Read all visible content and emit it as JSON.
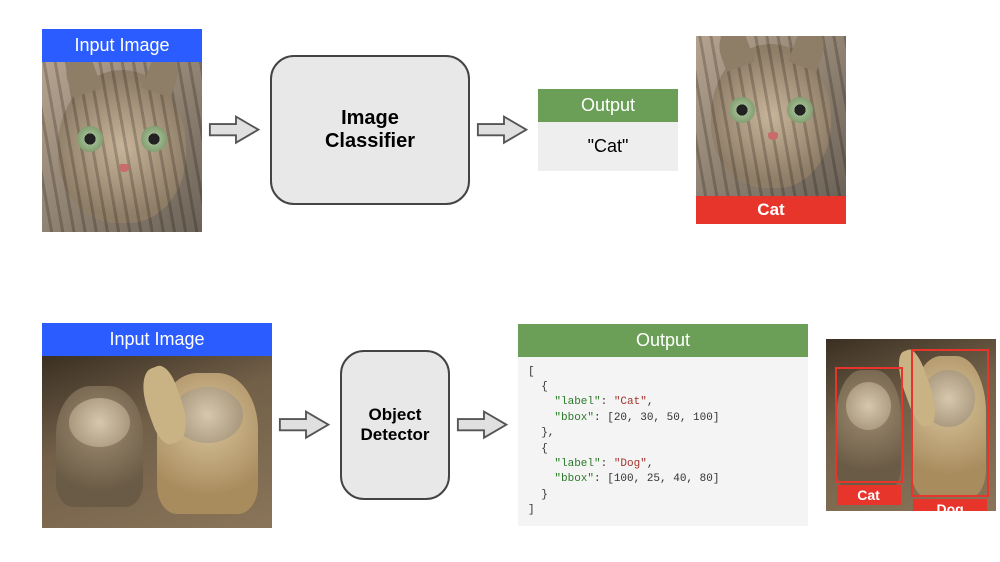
{
  "row1": {
    "input_label": "Input Image",
    "model_label": "Image Classifier",
    "output_header": "Output",
    "output_value": "\"Cat\"",
    "result_caption": "Cat"
  },
  "row2": {
    "input_label": "Input Image",
    "model_label": "Object Detector",
    "output_header": "Output",
    "json": {
      "open": "[",
      "item1": {
        "label_key": "\"label\"",
        "label_val": "\"Cat\"",
        "bbox_key": "\"bbox\"",
        "bbox_val": "[20, 30, 50, 100]"
      },
      "item2": {
        "label_key": "\"label\"",
        "label_val": "\"Dog\"",
        "bbox_key": "\"bbox\"",
        "bbox_val": "[100, 25, 40, 80]"
      },
      "close": "]"
    },
    "bbox1_caption": "Cat",
    "bbox2_caption": "Dog"
  },
  "colors": {
    "label_blue": "#2a5cff",
    "output_green": "#6b9e56",
    "tag_red": "#e7352c"
  }
}
